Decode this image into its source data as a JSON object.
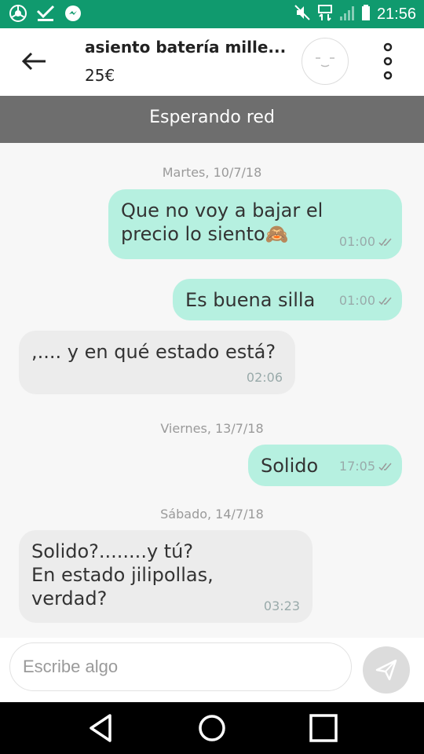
{
  "status_bar": {
    "time": "21:56",
    "left_icons": [
      "chrome-icon",
      "download-done-icon",
      "messenger-icon"
    ],
    "right_icons": [
      "mute-icon",
      "data-icon",
      "signal-icon",
      "battery-icon"
    ]
  },
  "header": {
    "title": "asiento batería mille...",
    "price": "25€"
  },
  "network_banner": "Esperando red",
  "messages": [
    {
      "date": "Martes, 10/7/18"
    },
    {
      "side": "out",
      "lines": [
        "Que no voy a bajar el",
        "precio lo siento🙈"
      ],
      "time": "01:00"
    },
    {
      "side": "out",
      "lines": [
        "Es buena silla"
      ],
      "time": "01:00"
    },
    {
      "side": "in",
      "lines": [
        ",.... y en qué estado está?"
      ],
      "time": "02:06"
    },
    {
      "date": "Viernes, 13/7/18"
    },
    {
      "side": "out",
      "lines": [
        "Solido"
      ],
      "time": "17:05"
    },
    {
      "date": "Sábado, 14/7/18"
    },
    {
      "side": "in",
      "lines": [
        "Solido?........y tú?",
        "En estado jilipollas,",
        "verdad?"
      ],
      "time": "03:23"
    }
  ],
  "composer": {
    "placeholder": "Escribe algo"
  },
  "nav": {
    "buttons": [
      "back",
      "home",
      "recents"
    ]
  },
  "colors": {
    "status_bar": "#109a6e",
    "outgoing_bubble": "#b6f0e0",
    "incoming_bubble": "#ececec",
    "banner": "#6e6e6e"
  }
}
